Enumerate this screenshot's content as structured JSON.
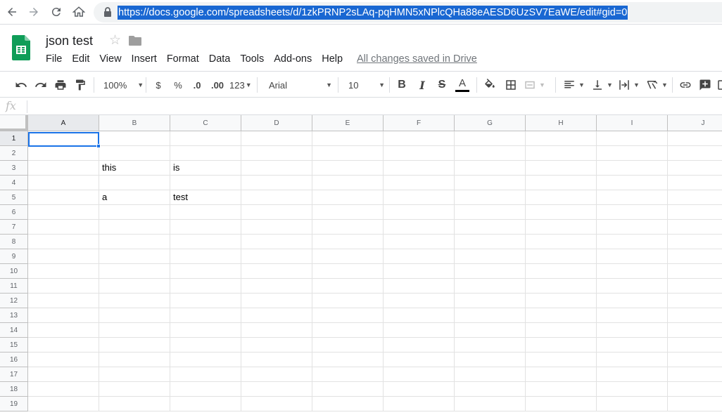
{
  "browser": {
    "url": "https://docs.google.com/spreadsheets/d/1zkPRNP2sLAq-pqHMN5xNPlcQHa88eAESD6UzSV7EaWE/edit#gid=0"
  },
  "doc": {
    "title": "json test",
    "saved_status": "All changes saved in Drive"
  },
  "menu": [
    "File",
    "Edit",
    "View",
    "Insert",
    "Format",
    "Data",
    "Tools",
    "Add-ons",
    "Help"
  ],
  "toolbar": {
    "zoom": "100%",
    "currency": "$",
    "percent": "%",
    "decrease_decimal": ".0",
    "increase_decimal": ".00",
    "more_formats": "123",
    "font": "Arial",
    "font_size": "10",
    "bold": "B",
    "italic": "I",
    "strike": "S",
    "text_color": "A"
  },
  "formula_bar": {
    "fx": "fx"
  },
  "grid": {
    "columns": [
      "A",
      "B",
      "C",
      "D",
      "E",
      "F",
      "G",
      "H",
      "I",
      "J"
    ],
    "rows": [
      {
        "num": "1",
        "cells": [
          "",
          "",
          "",
          "",
          "",
          "",
          "",
          "",
          "",
          ""
        ]
      },
      {
        "num": "2",
        "cells": [
          "",
          "",
          "",
          "",
          "",
          "",
          "",
          "",
          "",
          ""
        ]
      },
      {
        "num": "3",
        "cells": [
          "",
          "this",
          "is",
          "",
          "",
          "",
          "",
          "",
          "",
          ""
        ]
      },
      {
        "num": "4",
        "cells": [
          "",
          "",
          "",
          "",
          "",
          "",
          "",
          "",
          "",
          ""
        ]
      },
      {
        "num": "5",
        "cells": [
          "",
          "a",
          "test",
          "",
          "",
          "",
          "",
          "",
          "",
          ""
        ]
      },
      {
        "num": "6",
        "cells": [
          "",
          "",
          "",
          "",
          "",
          "",
          "",
          "",
          "",
          ""
        ]
      },
      {
        "num": "7",
        "cells": [
          "",
          "",
          "",
          "",
          "",
          "",
          "",
          "",
          "",
          ""
        ]
      },
      {
        "num": "8",
        "cells": [
          "",
          "",
          "",
          "",
          "",
          "",
          "",
          "",
          "",
          ""
        ]
      },
      {
        "num": "9",
        "cells": [
          "",
          "",
          "",
          "",
          "",
          "",
          "",
          "",
          "",
          ""
        ]
      },
      {
        "num": "10",
        "cells": [
          "",
          "",
          "",
          "",
          "",
          "",
          "",
          "",
          "",
          ""
        ]
      },
      {
        "num": "11",
        "cells": [
          "",
          "",
          "",
          "",
          "",
          "",
          "",
          "",
          "",
          ""
        ]
      },
      {
        "num": "12",
        "cells": [
          "",
          "",
          "",
          "",
          "",
          "",
          "",
          "",
          "",
          ""
        ]
      },
      {
        "num": "13",
        "cells": [
          "",
          "",
          "",
          "",
          "",
          "",
          "",
          "",
          "",
          ""
        ]
      },
      {
        "num": "14",
        "cells": [
          "",
          "",
          "",
          "",
          "",
          "",
          "",
          "",
          "",
          ""
        ]
      },
      {
        "num": "15",
        "cells": [
          "",
          "",
          "",
          "",
          "",
          "",
          "",
          "",
          "",
          ""
        ]
      },
      {
        "num": "16",
        "cells": [
          "",
          "",
          "",
          "",
          "",
          "",
          "",
          "",
          "",
          ""
        ]
      },
      {
        "num": "17",
        "cells": [
          "",
          "",
          "",
          "",
          "",
          "",
          "",
          "",
          "",
          ""
        ]
      },
      {
        "num": "18",
        "cells": [
          "",
          "",
          "",
          "",
          "",
          "",
          "",
          "",
          "",
          ""
        ]
      },
      {
        "num": "19",
        "cells": [
          "",
          "",
          "",
          "",
          "",
          "",
          "",
          "",
          "",
          ""
        ]
      }
    ],
    "selected_column": "A",
    "selected_row": "1"
  },
  "colors": {
    "brand_green": "#0f9d58",
    "selection_blue": "#1a73e8",
    "url_highlight": "#1967d2"
  }
}
